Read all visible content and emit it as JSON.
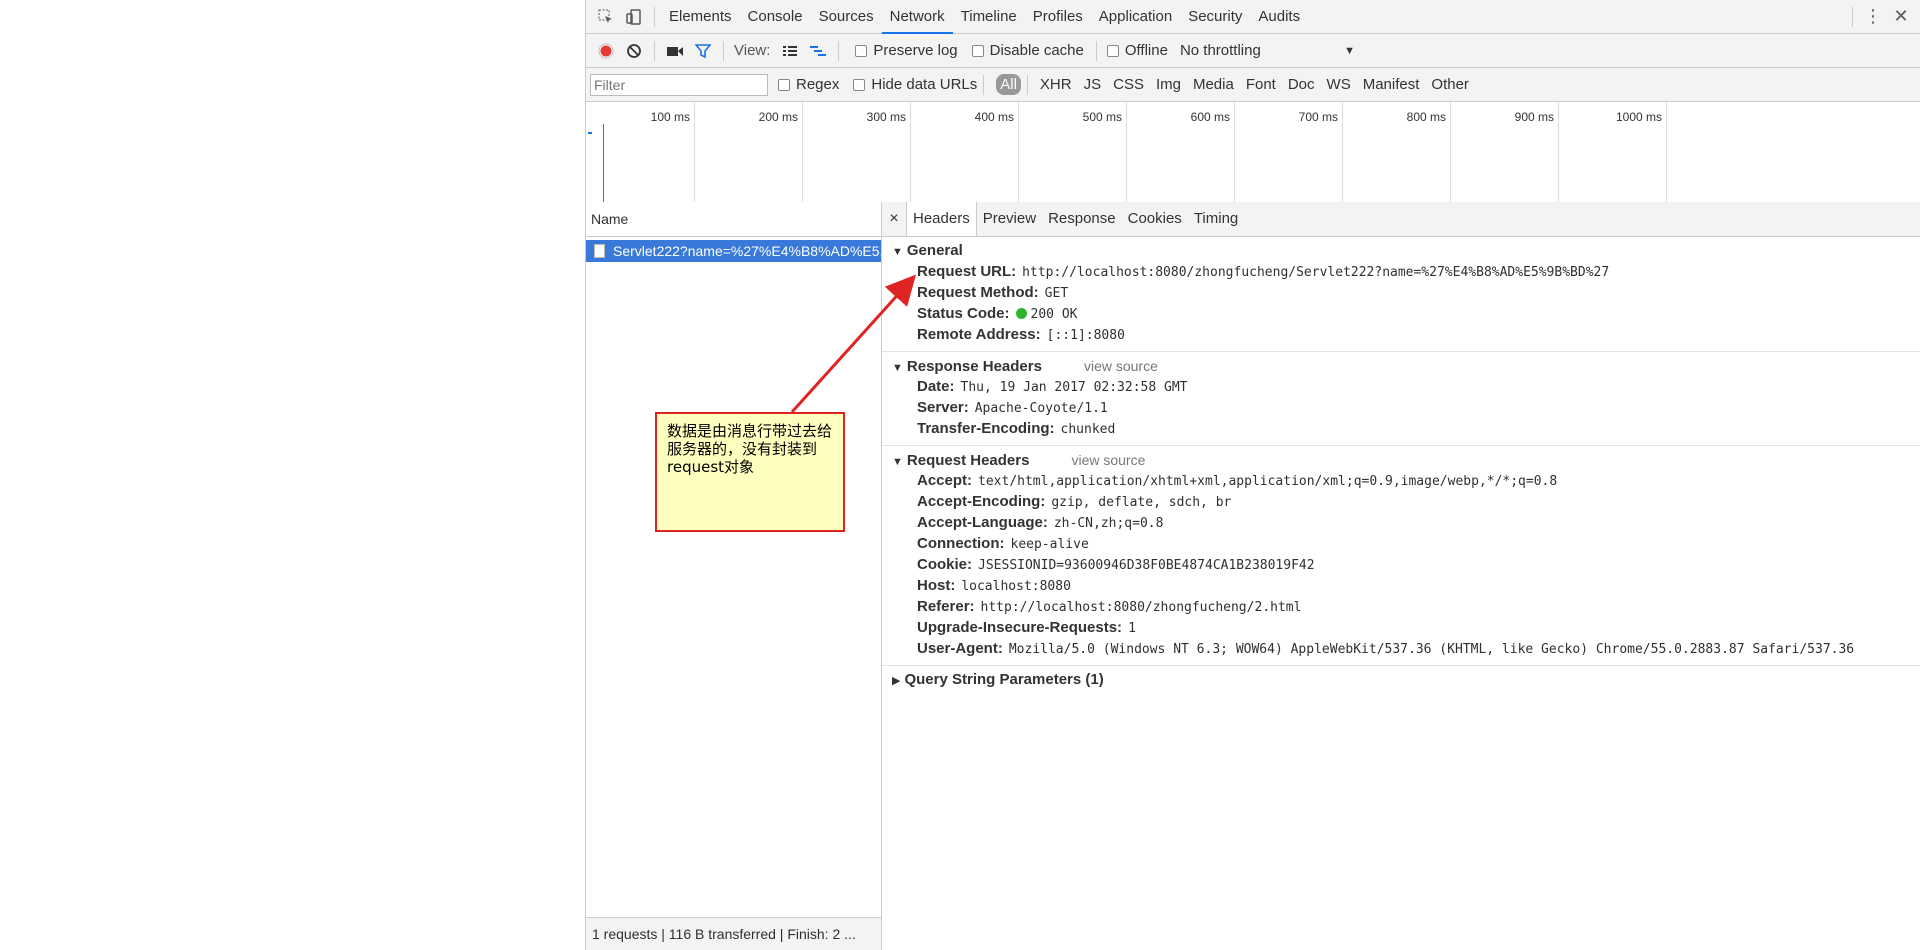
{
  "devtools": {
    "panel_tabs": [
      "Elements",
      "Console",
      "Sources",
      "Network",
      "Timeline",
      "Profiles",
      "Application",
      "Security",
      "Audits"
    ],
    "active_panel": "Network",
    "controls": {
      "view_label": "View:",
      "preserve_log": "Preserve log",
      "disable_cache": "Disable cache",
      "offline": "Offline",
      "throttling": "No throttling"
    },
    "filter": {
      "placeholder": "Filter",
      "regex": "Regex",
      "hide_data_urls": "Hide data URLs",
      "types": [
        "All",
        "XHR",
        "JS",
        "CSS",
        "Img",
        "Media",
        "Font",
        "Doc",
        "WS",
        "Manifest",
        "Other"
      ]
    },
    "timeline_labels": [
      "100 ms",
      "200 ms",
      "300 ms",
      "400 ms",
      "500 ms",
      "600 ms",
      "700 ms",
      "800 ms",
      "900 ms",
      "1000 ms"
    ],
    "requests": {
      "header": "Name",
      "items": [
        "Servlet222?name=%27%E4%B8%AD%E5..."
      ]
    },
    "summary": "1 requests  |  116 B transferred  |  Finish: 2 ...",
    "detail_tabs": [
      "Headers",
      "Preview",
      "Response",
      "Cookies",
      "Timing"
    ],
    "general": {
      "title": "General",
      "rows": [
        {
          "k": "Request URL:",
          "v": "http://localhost:8080/zhongfucheng/Servlet222?name=%27%E4%B8%AD%E5%9B%BD%27"
        },
        {
          "k": "Request Method:",
          "v": "GET"
        },
        {
          "k": "Status Code:",
          "v": "200 OK"
        },
        {
          "k": "Remote Address:",
          "v": "[::1]:8080"
        }
      ]
    },
    "response_headers": {
      "title": "Response Headers",
      "view_source": "view source",
      "rows": [
        {
          "k": "Date:",
          "v": "Thu, 19 Jan 2017 02:32:58 GMT"
        },
        {
          "k": "Server:",
          "v": "Apache-Coyote/1.1"
        },
        {
          "k": "Transfer-Encoding:",
          "v": "chunked"
        }
      ]
    },
    "request_headers": {
      "title": "Request Headers",
      "view_source": "view source",
      "rows": [
        {
          "k": "Accept:",
          "v": "text/html,application/xhtml+xml,application/xml;q=0.9,image/webp,*/*;q=0.8"
        },
        {
          "k": "Accept-Encoding:",
          "v": "gzip, deflate, sdch, br"
        },
        {
          "k": "Accept-Language:",
          "v": "zh-CN,zh;q=0.8"
        },
        {
          "k": "Connection:",
          "v": "keep-alive"
        },
        {
          "k": "Cookie:",
          "v": "JSESSIONID=93600946D38F0BE4874CA1B238019F42"
        },
        {
          "k": "Host:",
          "v": "localhost:8080"
        },
        {
          "k": "Referer:",
          "v": "http://localhost:8080/zhongfucheng/2.html"
        },
        {
          "k": "Upgrade-Insecure-Requests:",
          "v": "1"
        },
        {
          "k": "User-Agent:",
          "v": "Mozilla/5.0 (Windows NT 6.3; WOW64) AppleWebKit/537.36 (KHTML, like Gecko) Chrome/55.0.2883.87 Safari/537.36"
        }
      ]
    },
    "query_params": {
      "title": "Query String Parameters (1)"
    }
  },
  "annotation": {
    "text": "数据是由消息行带过去给服务器的，没有封装到request对象",
    "colors": {
      "border": "#e02424",
      "fill": "#ffffc0"
    }
  },
  "colors": {
    "accent": "#1a73e8",
    "selected_row": "#3879d9",
    "record": "#e53935",
    "status_ok": "#2cb52c"
  }
}
